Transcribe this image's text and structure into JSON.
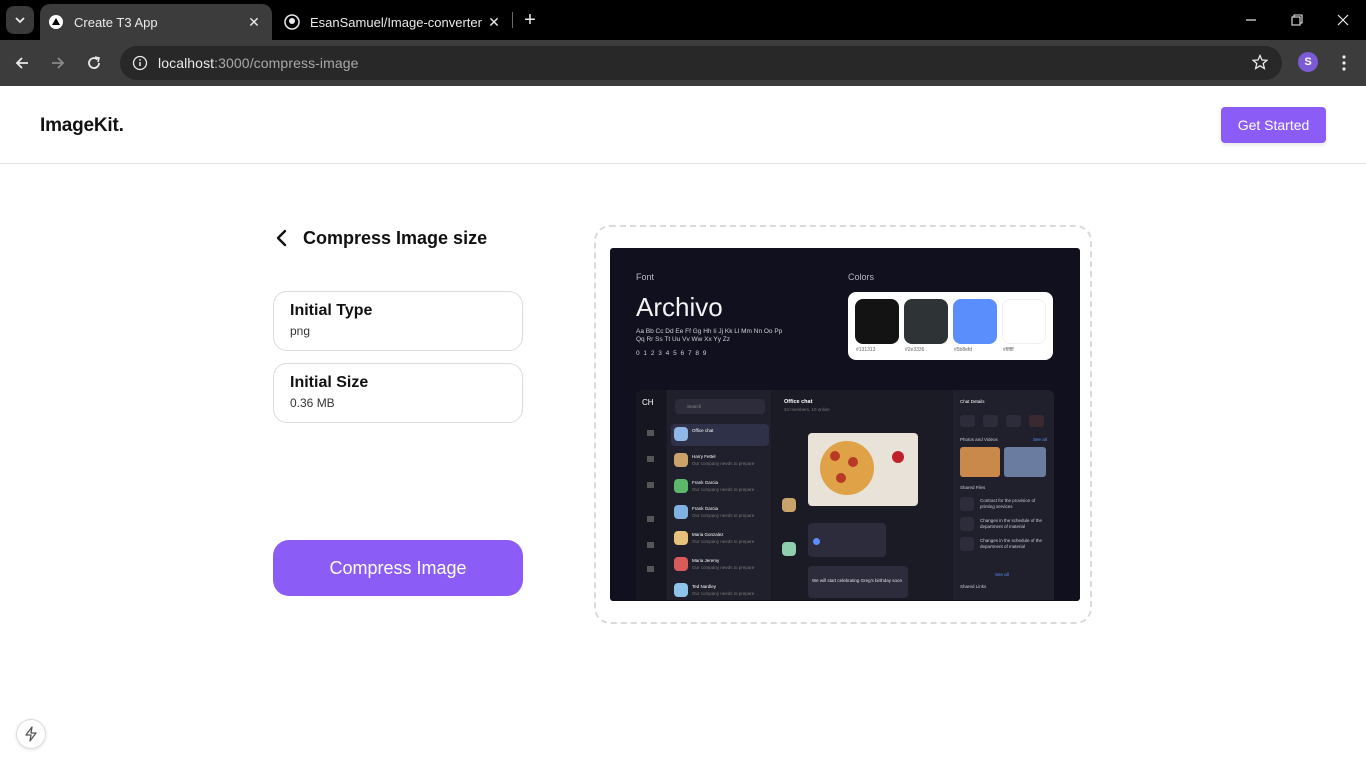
{
  "browser": {
    "tabs": [
      {
        "title": "Create T3 App",
        "active": true
      },
      {
        "title": "EsanSamuel/Image-converter",
        "active": false
      }
    ],
    "url": {
      "host": "localhost",
      "path": ":3000/compress-image"
    },
    "profile_initial": "S"
  },
  "header": {
    "logo": "ImageKit.",
    "cta": "Get Started"
  },
  "compress": {
    "heading": "Compress Image size",
    "initial_type_label": "Initial Type",
    "initial_type_value": "png",
    "initial_size_label": "Initial Size",
    "initial_size_value": "0.36 MB",
    "button": "Compress Image"
  },
  "preview": {
    "font_label": "Font",
    "font_name": "Archivo",
    "alphabet": "Aa Bb Cc Dd Ee Ff Gg Hh Ii Jj Kk Ll Mm Nn Oo Pp Qq Rr Ss Tt Uu Vv Ww Xx Yy Zz",
    "digits": "0 1 2 3 4 5 6 7 8 9",
    "colors_label": "Colors",
    "swatches": [
      {
        "hex": "#131313",
        "label": "#131313"
      },
      {
        "hex": "#2e3336",
        "label": "#2e3336"
      },
      {
        "hex": "#5b8efd",
        "label": "#5b8efd"
      },
      {
        "hex": "#ffffff",
        "label": "#ffffff"
      }
    ],
    "app": {
      "logo": "CH",
      "search": "Search",
      "chat_title": "Office chat",
      "chat_sub": "34 members, 10 online",
      "details_title": "Chat Details",
      "photos_label": "Photos and Videos",
      "see_all": "See all",
      "shared_files": "Shared Files",
      "shared_links": "Shared Links",
      "contacts": [
        "Office chat",
        "Harry Fettel",
        "Frank Garcia",
        "Frank Garcia",
        "Maria Gonzalez",
        "Maria Jeremy",
        "Ted Nardley"
      ],
      "preview_text": "Our company needs to prepare",
      "message": "We will start celebrating Greg's birthday soon",
      "files": [
        "Contract for the provision of printing services",
        "Changes in the schedule of the department of material",
        "Changes in the schedule of the department of material"
      ]
    }
  },
  "colors": {
    "accent": "#8b5cf6"
  }
}
